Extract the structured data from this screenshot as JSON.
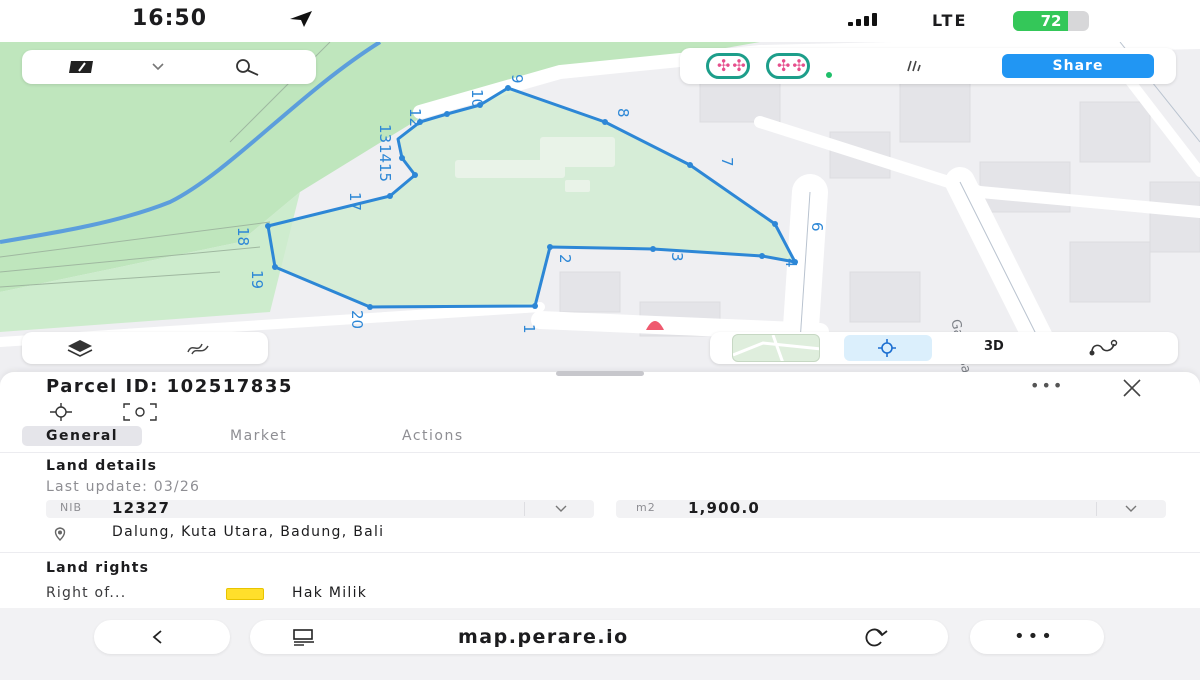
{
  "status_bar": {
    "time": "16:50",
    "network": "LTE",
    "battery_percent": "72",
    "battery_level": 0.72,
    "icons": [
      "location-arrow-icon",
      "signal-bars-icon",
      "battery-icon"
    ]
  },
  "map": {
    "street_label": "Gang Sandat",
    "parcel_point_labels": [
      "1",
      "2",
      "3",
      "4",
      "6",
      "7",
      "8",
      "9",
      "10",
      "12",
      "13",
      "14",
      "15",
      "17",
      "18",
      "19",
      "20"
    ],
    "colors": {
      "parcel_line": "#2d87d6",
      "parcel_fill": "#cdeccd",
      "park": "#bfe6bd",
      "river": "#4a90e2",
      "road": "#ffffff",
      "map_bg": "#efeff2"
    }
  },
  "map_controls": {
    "top_left": {
      "icons": [
        "layers-brand-icon",
        "chevron-down-icon",
        "search-icon"
      ]
    },
    "top_right": {
      "avatars": [
        "team-avatar-1",
        "team-avatar-2"
      ],
      "icons": [
        "measure-icon"
      ],
      "share_label": "Share",
      "share_color": "#2196f3"
    },
    "bottom_left": {
      "icons": [
        "layers-icon",
        "contour-icon"
      ]
    },
    "bottom_right": {
      "icons": [
        "map-thumbnail",
        "locate-target-icon",
        "route-icon"
      ],
      "label_3d": "3D"
    }
  },
  "sheet": {
    "title": "Parcel ID: 102517835",
    "icons": [
      "more-icon",
      "close-icon",
      "locate-parcel-icon",
      "scan-icon"
    ],
    "tabs": [
      {
        "label": "General",
        "active": true
      },
      {
        "label": "Market",
        "active": false
      },
      {
        "label": "Actions",
        "active": false
      }
    ],
    "land_details": {
      "title": "Land details",
      "last_update": "Last update: 03/26",
      "nib_label": "NIB",
      "nib_value": "12327",
      "area_label": "m2",
      "area_value": "1,900.0",
      "address": "Dalung, Kuta Utara, Badung, Bali"
    },
    "land_rights": {
      "title": "Land rights",
      "right_label": "Right of...",
      "right_value": "Hak Milik",
      "swatch_color": "#ffdf2b"
    }
  },
  "browser": {
    "url": "map.perare.io",
    "icons": [
      "back-icon",
      "tabs-icon",
      "reload-icon",
      "more-icon"
    ]
  }
}
